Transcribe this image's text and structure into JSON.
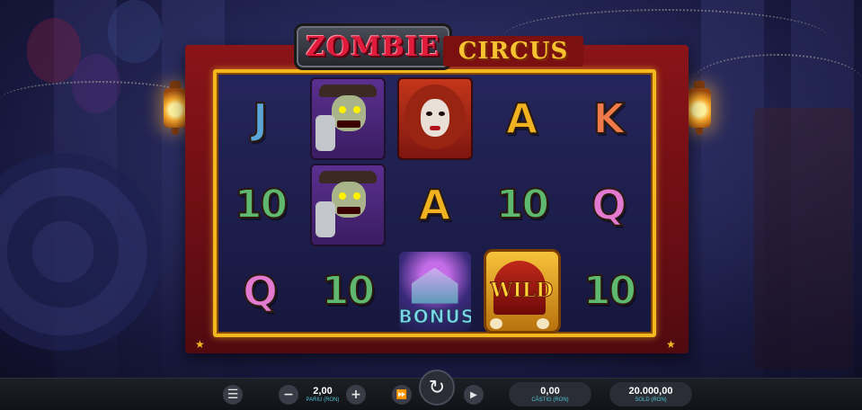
{
  "game": {
    "logo_word1": "ZOMBIE",
    "logo_word2": "CIRCUS"
  },
  "reels": [
    [
      {
        "type": "letter",
        "label": "J",
        "color": "#5aa4d8"
      },
      {
        "type": "number",
        "label": "10",
        "color": "#5fb870"
      },
      {
        "type": "letter",
        "label": "Q",
        "color": "#e27ad0"
      }
    ],
    [
      {
        "type": "card",
        "kind": "zombie-ringmaster"
      },
      {
        "type": "card",
        "kind": "zombie-ringmaster"
      },
      {
        "type": "number",
        "label": "10",
        "color": "#5fb870"
      }
    ],
    [
      {
        "type": "card",
        "kind": "zombie-lady"
      },
      {
        "type": "letter",
        "label": "A",
        "color": "#f0b220"
      },
      {
        "type": "bonus",
        "label": "BONUS"
      }
    ],
    [
      {
        "type": "letter",
        "label": "A",
        "color": "#f0b220"
      },
      {
        "type": "number",
        "label": "10",
        "color": "#5fb870"
      },
      {
        "type": "wild",
        "label": "WILD"
      }
    ],
    [
      {
        "type": "letter",
        "label": "K",
        "color": "#f07a4a"
      },
      {
        "type": "letter",
        "label": "Q",
        "color": "#e27ad0"
      },
      {
        "type": "number",
        "label": "10",
        "color": "#5fb870"
      }
    ]
  ],
  "controls": {
    "menu_icon": "menu-icon",
    "bet_value": "2,00",
    "bet_label": "PARIU (RON)",
    "minus_icon": "minus-icon",
    "plus_icon": "plus-icon",
    "autoplay_icon": "fast-forward-icon",
    "spin_icon": "spin-icon",
    "play_icon": "play-icon",
    "win_value": "0,00",
    "win_label": "CÂȘTIG (RON)",
    "balance_value": "20.000,00",
    "balance_label": "SOLD (RON)"
  },
  "colors": {
    "accent_gold": "#f2b81e",
    "curtain_red": "#8a1418",
    "label_cyan": "#4fc3d0"
  }
}
